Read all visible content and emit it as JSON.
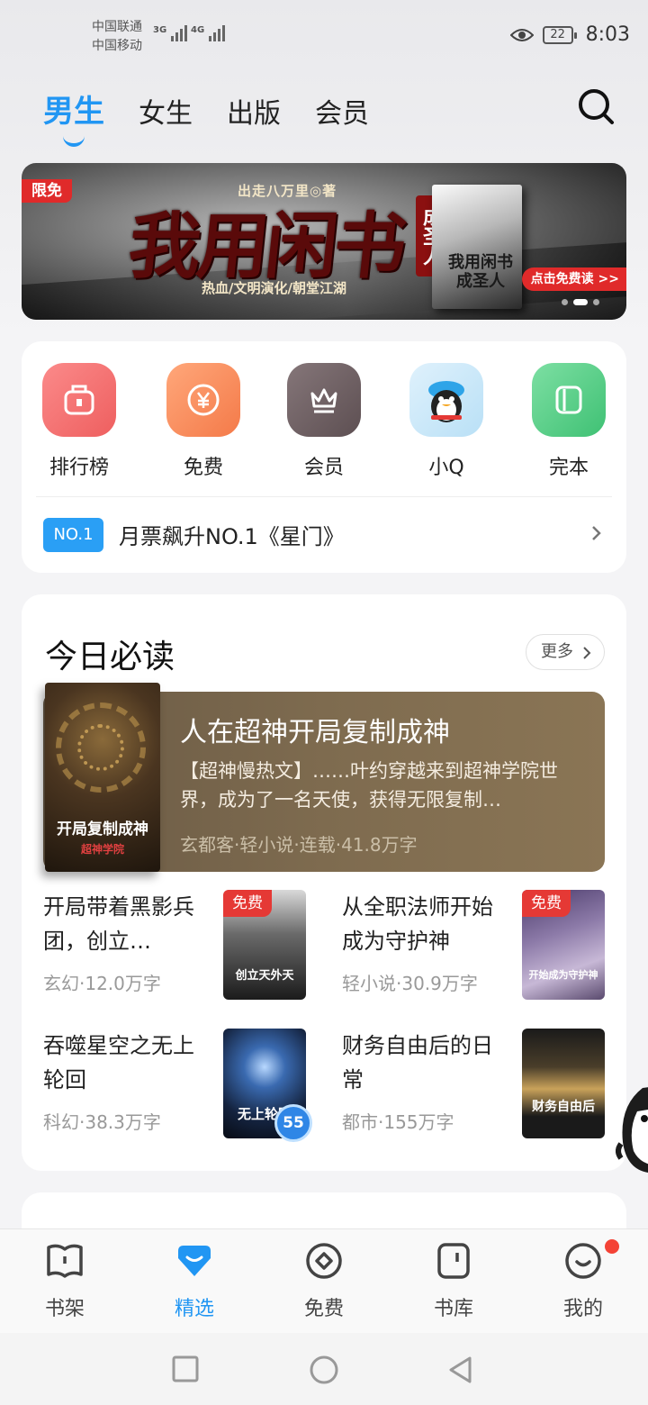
{
  "status_bar": {
    "carrier1": "中国联通",
    "carrier2": "中国移动",
    "net1": "3G",
    "net2": "4G",
    "battery": "22",
    "time": "8:03"
  },
  "top_tabs": [
    {
      "label": "男生",
      "active": true
    },
    {
      "label": "女生",
      "active": false
    },
    {
      "label": "出版",
      "active": false
    },
    {
      "label": "会员",
      "active": false
    }
  ],
  "banner": {
    "tag": "限免",
    "author": "出走八万里◎著",
    "title": "我用闲书",
    "subtitle": "成圣人",
    "genres": "热血/文明演化/朝堂江湖",
    "book_title": "我用闲书成圣人",
    "cta": "点击免费读 >>"
  },
  "quick_entries": [
    {
      "label": "排行榜",
      "icon": "trophy-icon",
      "color": "#f26d6d"
    },
    {
      "label": "免费",
      "icon": "yen-coin-icon",
      "color": "#f78a5a"
    },
    {
      "label": "会员",
      "icon": "crown-icon",
      "color": "#6e5f62"
    },
    {
      "label": "小Q",
      "icon": "penguin-icon",
      "color": "#8fcdf0"
    },
    {
      "label": "完本",
      "icon": "book-icon",
      "color": "#4ccb7f"
    }
  ],
  "notice": {
    "badge": "NO.1",
    "text": "月票飙升NO.1《星门》"
  },
  "today": {
    "title": "今日必读",
    "more": "更多",
    "feature": {
      "title": "人在超神开局复制成神",
      "desc": "【超神慢热文】……叶约穿越来到超神学院世界，成为了一名天使，获得无限复制…",
      "meta": "玄都客·轻小说·连载·41.8万字",
      "cover_text": "开局复制成神",
      "cover_red": "超神学院"
    },
    "books": [
      {
        "title": "开局带着黑影兵团，创立…",
        "meta": "玄幻·12.0万字",
        "free": "免费",
        "cover_text": "创立天外天"
      },
      {
        "title": "从全职法师开始成为守护神",
        "meta": "轻小说·30.9万字",
        "free": "免费",
        "cover_text": "开始成为守护神"
      },
      {
        "title": "吞噬星空之无上轮回",
        "meta": "科幻·38.3万字",
        "cover_text": "无上轮回",
        "badge": "55"
      },
      {
        "title": "财务自由后的日常",
        "meta": "都市·155万字",
        "cover_text": "财务自由后"
      }
    ]
  },
  "bottom_nav": [
    {
      "label": "书架",
      "icon": "bookshelf-icon",
      "active": false
    },
    {
      "label": "精选",
      "icon": "diamond-icon",
      "active": true
    },
    {
      "label": "免费",
      "icon": "free-target-icon",
      "active": false
    },
    {
      "label": "书库",
      "icon": "library-icon",
      "active": false
    },
    {
      "label": "我的",
      "icon": "smiley-icon",
      "active": false
    }
  ],
  "colors": {
    "accent": "#2196f3",
    "free_red": "#e53935",
    "no1_blue": "#2a9ff5"
  }
}
